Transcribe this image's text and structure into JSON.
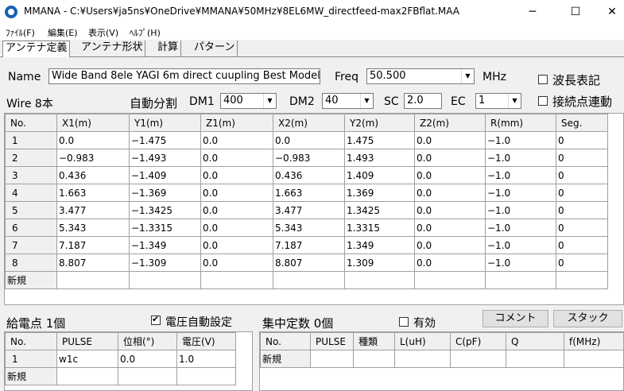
{
  "window": {
    "title": "MMANA - C:¥Users¥ja5ns¥OneDrive¥MMANA¥50MHz¥8EL6MW_directfeed-max2FBflat.MAA",
    "minimize": "─",
    "maximize": "☐",
    "close": "✕"
  },
  "menu": [
    "ﾌｧｲﾙ(F)",
    "編集(E)",
    "表示(V)",
    "ﾍﾙﾌﾟ(H)"
  ],
  "tabs": [
    "アンテナ定義",
    "アンテナ形状",
    "計算",
    "パターン"
  ],
  "antenna": {
    "name_label": "Name",
    "name_value": "Wide Band 8ele YAGI 6m direct cuupling Best Model",
    "freq_label": "Freq",
    "freq_value": "50.500",
    "freq_unit": "MHz",
    "wavelength_label": "波長表記",
    "feed_connect_label": "接続点連動"
  },
  "wire_bar": {
    "wire_count": "Wire 8本",
    "auto_split_label": "自動分割",
    "dm1_label": "DM1",
    "dm1_value": "400",
    "dm2_label": "DM2",
    "dm2_value": "40",
    "sc_label": "SC",
    "sc_value": "2.0",
    "ec_label": "EC",
    "ec_value": "1"
  },
  "wire_table": {
    "headers": [
      "No.",
      "X1(m)",
      "Y1(m)",
      "Z1(m)",
      "X2(m)",
      "Y2(m)",
      "Z2(m)",
      "R(mm)",
      "Seg."
    ],
    "rows": [
      [
        "1",
        "0.0",
        "−1.475",
        "0.0",
        "0.0",
        "1.475",
        "0.0",
        "−1.0",
        "0"
      ],
      [
        "2",
        "−0.983",
        "−1.493",
        "0.0",
        "−0.983",
        "1.493",
        "0.0",
        "−1.0",
        "0"
      ],
      [
        "3",
        "0.436",
        "−1.409",
        "0.0",
        "0.436",
        "1.409",
        "0.0",
        "−1.0",
        "0"
      ],
      [
        "4",
        "1.663",
        "−1.369",
        "0.0",
        "1.663",
        "1.369",
        "0.0",
        "−1.0",
        "0"
      ],
      [
        "5",
        "3.477",
        "−1.3425",
        "0.0",
        "3.477",
        "1.3425",
        "0.0",
        "−1.0",
        "0"
      ],
      [
        "6",
        "5.343",
        "−1.3315",
        "0.0",
        "5.343",
        "1.3315",
        "0.0",
        "−1.0",
        "0"
      ],
      [
        "7",
        "7.187",
        "−1.349",
        "0.0",
        "7.187",
        "1.349",
        "0.0",
        "−1.0",
        "0"
      ],
      [
        "8",
        "8.807",
        "−1.309",
        "0.0",
        "8.807",
        "1.309",
        "0.0",
        "−1.0",
        "0"
      ]
    ],
    "new_row": "新規"
  },
  "feed": {
    "label": "給電点 1個",
    "auto_voltage_label": "電圧自動設定",
    "headers": [
      "No.",
      "PULSE",
      "位相(°)",
      "電圧(V)"
    ],
    "rows": [
      [
        "1",
        "w1c",
        "0.0",
        "1.0"
      ]
    ],
    "new_row": "新規"
  },
  "lumped": {
    "label": "集中定数 0個",
    "enable_label": "有効",
    "comment_button": "コメント",
    "stack_button": "スタック",
    "headers": [
      "No.",
      "PULSE",
      "種類",
      "L(uH)",
      "C(pF)",
      "Q",
      "f(MHz)"
    ],
    "new_row": "新規"
  }
}
